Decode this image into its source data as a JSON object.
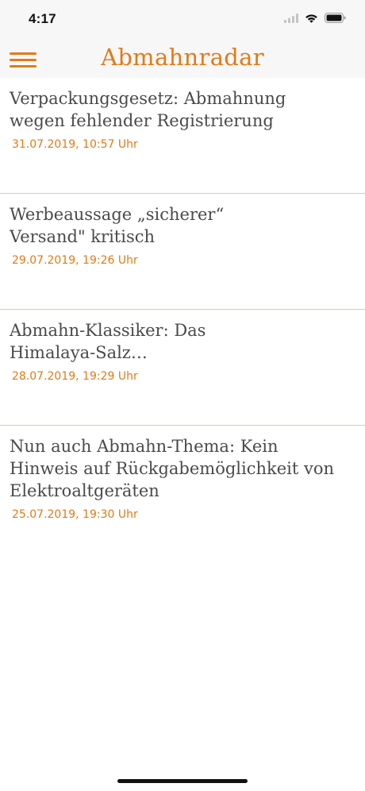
{
  "status_bar": {
    "time": "4:17",
    "icons": [
      "signal-icon",
      "wifi-icon",
      "battery-icon"
    ]
  },
  "header": {
    "title": "Abmahnradar",
    "menu_icon": "hamburger-menu-icon"
  },
  "colors": {
    "accent": "#e07b18",
    "title_text": "#4a4a4a",
    "divider": "#ecc79a",
    "bar_background": "#f7f7f7"
  },
  "articles": [
    {
      "title_lines": [
        "Verpackungsgesetz: Abmahnung",
        "wegen fehlender Registrierung"
      ],
      "date": "31.07.2019, 10:57 Uhr"
    },
    {
      "title_lines": [
        "Werbeaussage „sicherer“",
        "Versand\" kritisch"
      ],
      "date": "29.07.2019, 19:26 Uhr"
    },
    {
      "title_lines": [
        "Abmahn-Klassiker: Das",
        "Himalaya-Salz…"
      ],
      "date": "28.07.2019, 19:29 Uhr"
    },
    {
      "title_lines": [
        "Nun auch Abmahn-Thema: Kein",
        "Hinweis auf Rückgabemöglichkeit von",
        "Elektroaltgeräten"
      ],
      "date": "25.07.2019, 19:30 Uhr"
    }
  ]
}
